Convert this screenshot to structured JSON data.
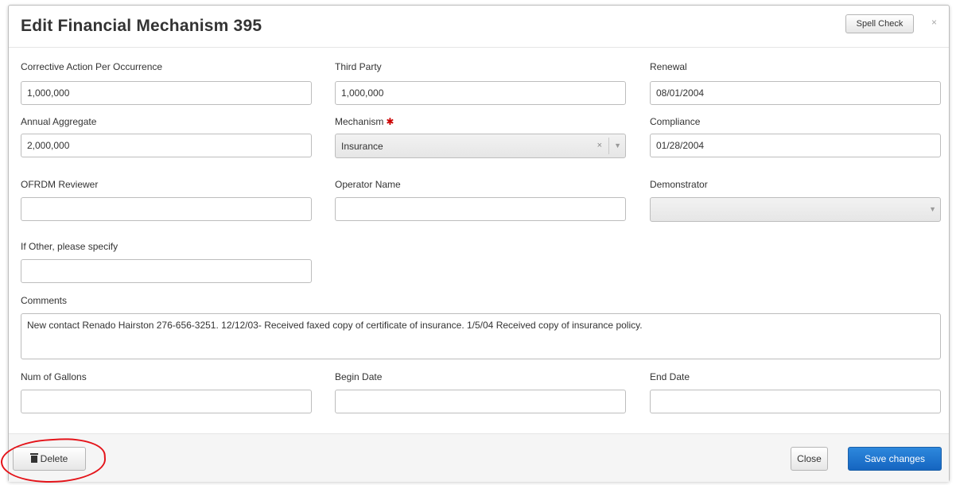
{
  "modal": {
    "title": "Edit Financial Mechanism 395",
    "spell_check_label": "Spell Check",
    "close_x": "×"
  },
  "fields": {
    "corrective_action": {
      "label": "Corrective Action Per Occurrence",
      "value": "1,000,000"
    },
    "third_party": {
      "label": "Third Party",
      "value": "1,000,000"
    },
    "renewal": {
      "label": "Renewal",
      "value": "08/01/2004"
    },
    "annual_aggregate": {
      "label": "Annual Aggregate",
      "value": "2,000,000"
    },
    "mechanism": {
      "label": "Mechanism",
      "required_marker": "✱",
      "value": "Insurance",
      "clear": "×",
      "caret": "▼"
    },
    "compliance": {
      "label": "Compliance",
      "value": "01/28/2004"
    },
    "ofrdm_reviewer": {
      "label": "OFRDM Reviewer",
      "value": ""
    },
    "operator_name": {
      "label": "Operator Name",
      "value": ""
    },
    "demonstrator": {
      "label": "Demonstrator",
      "value": "",
      "caret": "▼"
    },
    "if_other": {
      "label": "If Other, please specify",
      "value": ""
    },
    "comments": {
      "label": "Comments",
      "value": "New contact Renado Hairston 276-656-3251. 12/12/03- Received faxed copy of certificate of insurance.  1/5/04 Received copy of insurance policy."
    },
    "num_gallons": {
      "label": "Num of Gallons",
      "value": ""
    },
    "begin_date": {
      "label": "Begin Date",
      "value": ""
    },
    "end_date": {
      "label": "End Date",
      "value": ""
    }
  },
  "footer": {
    "delete_label": "Delete",
    "close_label": "Close",
    "save_label": "Save changes"
  },
  "icons": {
    "delete": "trash-icon"
  },
  "colors": {
    "primary": "#1565c0",
    "required": "#cc0000",
    "annotation_circle": "#e4141a"
  }
}
